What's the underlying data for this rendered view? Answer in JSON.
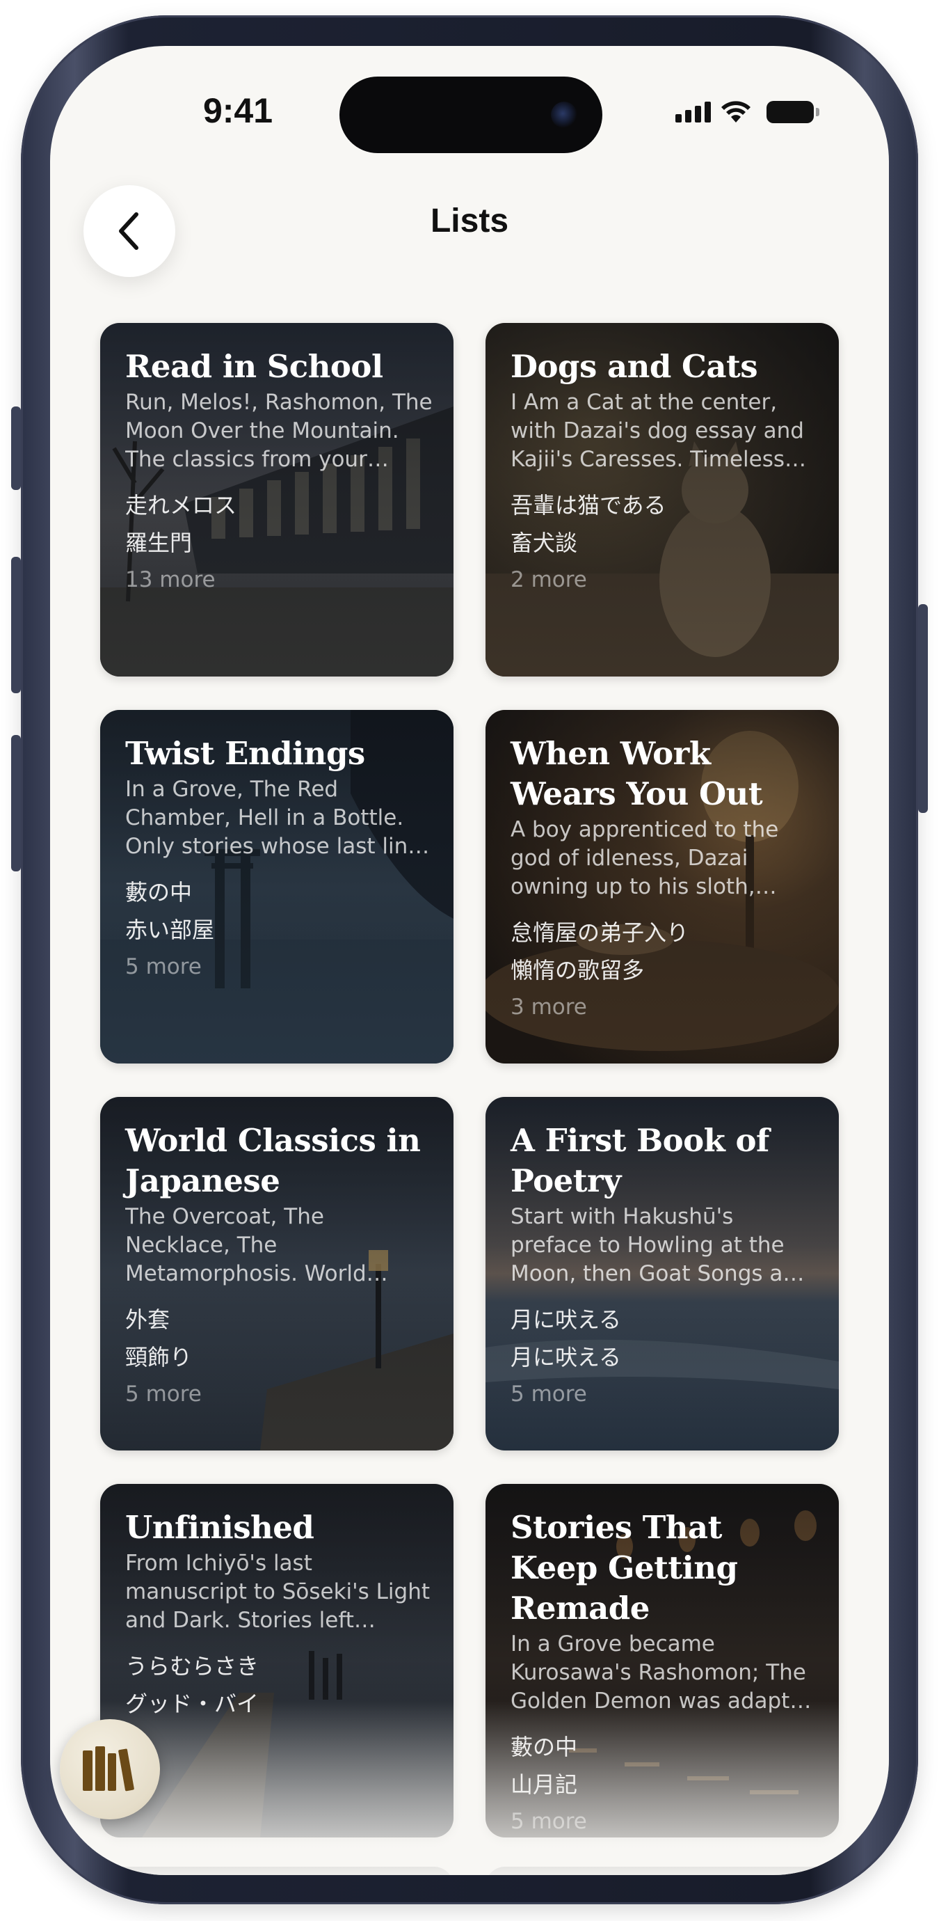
{
  "status_bar": {
    "time": "9:41"
  },
  "header": {
    "title": "Lists"
  },
  "colors": {
    "background": "#f8f7f4",
    "fab_icon": "#6b4a17",
    "card_shade": "#0a0c10"
  },
  "icons": {
    "back": "chevron-left-icon",
    "library": "books-icon",
    "signal": "signal-icon",
    "wifi": "wifi-icon",
    "battery": "battery-icon"
  },
  "cards": [
    {
      "title": "Read in School",
      "description": "Run, Melos!, Rashomon, The Moon Over the Mountain. The classics from your school textbooks.",
      "books": [
        "走れメロス",
        "羅生門"
      ],
      "more": "13 more"
    },
    {
      "title": "Dogs and Cats",
      "description": "I Am a Cat at the center, with Dazai's dog essay and Kajii's Caresses. Timeless pets.",
      "books": [
        "吾輩は猫である",
        "畜犬談"
      ],
      "more": "2 more"
    },
    {
      "title": "Twist Endings",
      "description": "In a Grove, The Red Chamber, Hell in a Bottle. Only stories whose last line changes everything.",
      "books": [
        "藪の中",
        "赤い部屋"
      ],
      "more": "5 more"
    },
    {
      "title": "When Work Wears You Out",
      "description": "A boy apprenticed to the god of idleness, Dazai owning up to his sloth, Tokens of rest.",
      "books": [
        "怠惰屋の弟子入り",
        "懶惰の歌留多"
      ],
      "more": "3 more"
    },
    {
      "title": "World Classics in Japanese",
      "description": "The Overcoat, The Necklace, The Metamorphosis. World classics in Japanese translation.",
      "books": [
        "外套",
        "頸飾り"
      ],
      "more": "5 more"
    },
    {
      "title": "A First Book of Poetry",
      "description": "Start with Hakushū's preface to Howling at the Moon, then Goat Songs and beyond.",
      "books": [
        "月に吠える",
        "月に吠える"
      ],
      "more": "5 more"
    },
    {
      "title": "Unfinished",
      "description": "From Ichiyō's last manuscript to Sōseki's Light and Dark. Stories left unfinished.",
      "books": [
        "うらむらさき",
        "グッド・バイ"
      ],
      "more": ""
    },
    {
      "title": "Stories That Keep Getting Remade",
      "description": "In a Grove became Kurosawa's Rashomon; The Golden Demon was adapted again and again.",
      "books": [
        "藪の中",
        "山月記"
      ],
      "more": "5 more"
    }
  ]
}
